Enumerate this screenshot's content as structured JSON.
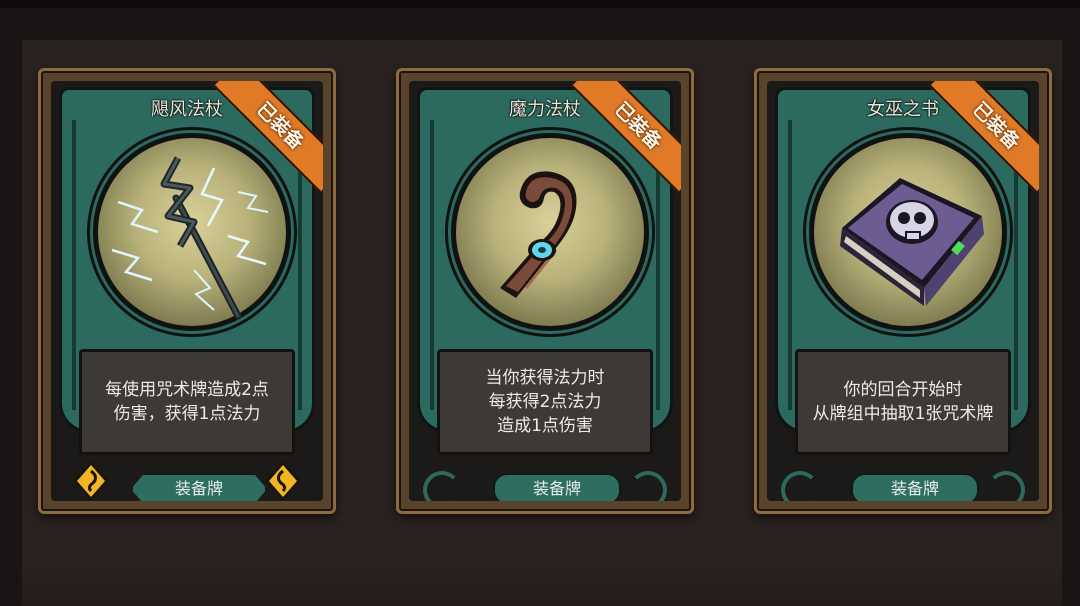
{
  "cards": [
    {
      "name": "飓风法杖",
      "badge": "已装备",
      "description": [
        "每使用咒术牌造成2点",
        "伤害，获得1点法力"
      ],
      "button_label": "装备牌",
      "art_icon": "lightning-staff-icon"
    },
    {
      "name": "魔力法杖",
      "badge": "已装备",
      "description": [
        "当你获得法力时",
        "每获得2点法力",
        "造成1点伤害"
      ],
      "button_label": "装备牌",
      "art_icon": "hooked-wooden-staff-icon"
    },
    {
      "name": "女巫之书",
      "badge": "已装备",
      "description": [
        "你的回合开始时",
        "从牌组中抽取1张咒术牌"
      ],
      "button_label": "装备牌",
      "art_icon": "skull-spellbook-icon"
    }
  ],
  "colors": {
    "frame_teal": "#2c6a5f",
    "badge_orange": "#e07a26",
    "card_border": "#8e6a3f",
    "rune_gold": "#f0b623"
  }
}
